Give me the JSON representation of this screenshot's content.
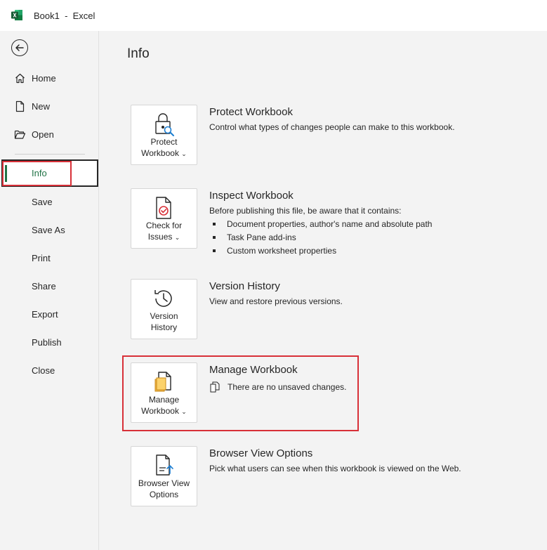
{
  "titlebar": {
    "title": "Book1  -  Excel"
  },
  "sidebar": {
    "items": [
      {
        "label": "Home"
      },
      {
        "label": "New"
      },
      {
        "label": "Open"
      },
      {
        "label": "Info"
      },
      {
        "label": "Save"
      },
      {
        "label": "Save As"
      },
      {
        "label": "Print"
      },
      {
        "label": "Share"
      },
      {
        "label": "Export"
      },
      {
        "label": "Publish"
      },
      {
        "label": "Close"
      }
    ]
  },
  "main": {
    "title": "Info",
    "sections": [
      {
        "button": {
          "line1": "Protect",
          "line2": "Workbook",
          "icon": "lock-icon"
        },
        "title": "Protect Workbook",
        "description": "Control what types of changes people can make to this workbook."
      },
      {
        "button": {
          "line1": "Check for",
          "line2": "Issues",
          "icon": "inspect-icon"
        },
        "title": "Inspect Workbook",
        "description": "Before publishing this file, be aware that it contains:",
        "bullets": [
          "Document properties, author's name and absolute path",
          "Task Pane add-ins",
          "Custom worksheet properties"
        ]
      },
      {
        "button": {
          "line1": "Version",
          "line2": "History",
          "icon": "history-icon"
        },
        "title": "Version History",
        "description": "View and restore previous versions."
      },
      {
        "button": {
          "line1": "Manage",
          "line2": "Workbook",
          "icon": "manage-icon"
        },
        "title": "Manage Workbook",
        "description": "There are no unsaved changes."
      },
      {
        "button": {
          "line1": "Browser View",
          "line2": "Options",
          "icon": "browser-view-icon"
        },
        "title": "Browser View Options",
        "description": "Pick what users can see when this workbook is viewed on the Web."
      }
    ]
  },
  "colors": {
    "accent": "#217346",
    "highlight": "#d83038"
  }
}
